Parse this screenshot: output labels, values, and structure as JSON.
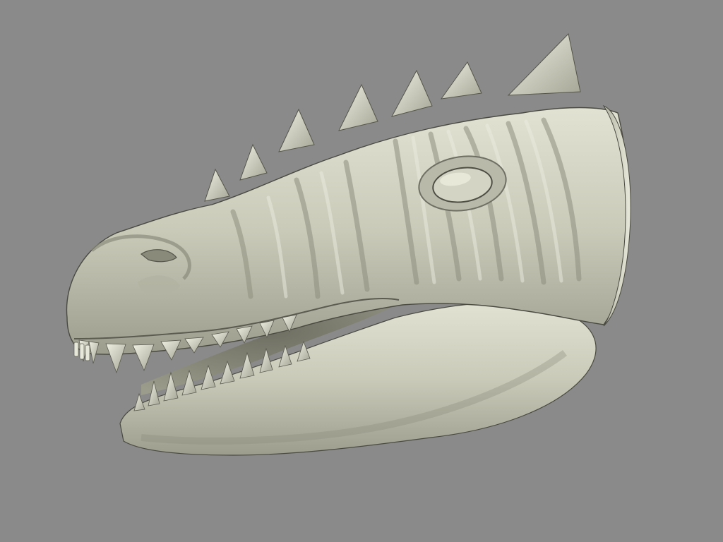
{
  "scene": {
    "subject": "sculpted-dragon-head",
    "background_color": "#8a8a8a",
    "material_color": "#c9c9b8",
    "material_shadow_color": "#7e7e70",
    "material_highlight_color": "#e6e6d8",
    "outline_color": "#3f3f38"
  }
}
